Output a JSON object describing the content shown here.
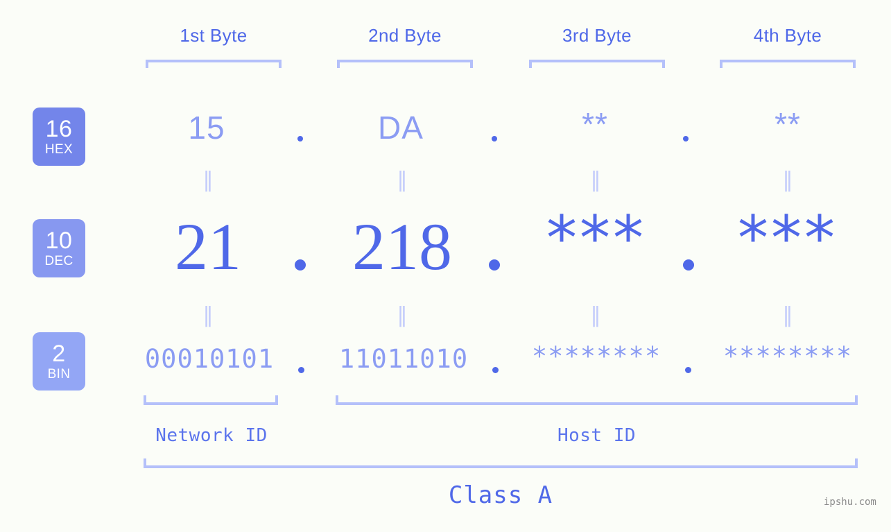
{
  "background": "#fbfdf8",
  "colors": {
    "accent": "#4f68e8",
    "accent_light": "#8b9cf3",
    "bracket": "#b4c0fa",
    "badge_hex": "#7385ea",
    "badge_dec": "#8798f0",
    "badge_bin": "#93a6f5"
  },
  "byte_headers": [
    {
      "label": "1st Byte"
    },
    {
      "label": "2nd Byte"
    },
    {
      "label": "3rd Byte"
    },
    {
      "label": "4th Byte"
    }
  ],
  "bases": [
    {
      "number": "16",
      "name": "HEX"
    },
    {
      "number": "10",
      "name": "DEC"
    },
    {
      "number": "2",
      "name": "BIN"
    }
  ],
  "rows": {
    "hex": {
      "values": [
        "15",
        "DA",
        "**",
        "**"
      ]
    },
    "dec": {
      "values": [
        "21",
        "218",
        "***",
        "***"
      ]
    },
    "bin": {
      "values": [
        "00010101",
        "11011010",
        "********",
        "********"
      ]
    }
  },
  "separators": {
    "equals": "‖",
    "dot": "."
  },
  "segments": {
    "network_id": "Network ID",
    "host_id": "Host ID",
    "class": "Class A"
  },
  "watermark": "ipshu.com"
}
